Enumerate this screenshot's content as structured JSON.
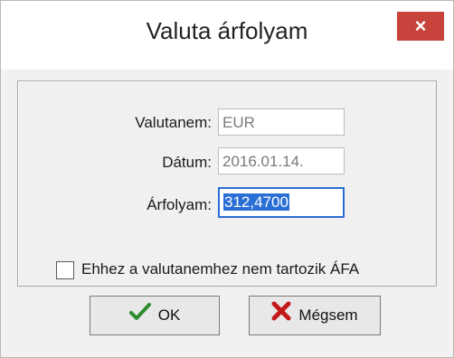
{
  "dialog": {
    "title": "Valuta árfolyam",
    "close_glyph": "×"
  },
  "fields": {
    "currency": {
      "label": "Valutanem:",
      "value": "EUR"
    },
    "date": {
      "label": "Dátum:",
      "value": "2016.01.14."
    },
    "rate": {
      "label": "Árfolyam:",
      "value": "312,4700"
    }
  },
  "checkbox": {
    "label": "Ehhez a valutanemhez nem tartozik ÁFA",
    "checked": false
  },
  "buttons": {
    "ok": {
      "label": "OK",
      "icon": "checkmark-icon",
      "color": "#2e8b2e"
    },
    "cancel": {
      "label": "Mégsem",
      "icon": "x-icon",
      "color": "#c21a1a"
    }
  },
  "colors": {
    "accent": "#2a6fd6",
    "close_button": "#c7433b"
  }
}
